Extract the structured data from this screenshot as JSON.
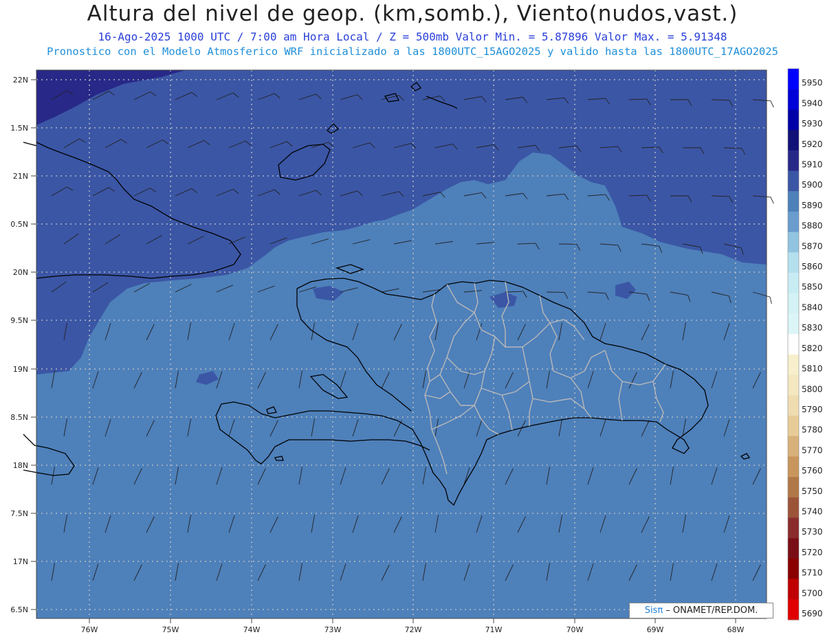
{
  "title": "Altura del nivel de geop. (km,somb.), Viento(nudos,vast.)",
  "subtitle_line1": "16-Ago-2025  1000 UTC / 7:00 am Hora Local / Z = 500mb    Valor Min. = 5.87896  Valor Max. = 5.91348",
  "subtitle_line2": "Pronostico con el Modelo Atmosferico WRF inicializado a las 1800UTC_15AGO2025 y valido hasta las  1800UTC_17AGO2025",
  "map": {
    "lat_labels": [
      "22N",
      "1.5N",
      "21N",
      "0.5N",
      "20N",
      "9.5N",
      "19N",
      "8.5N",
      "18N",
      "7.5N",
      "17N",
      "6.5N"
    ],
    "lon_labels": [
      "76W",
      "75W",
      "74W",
      "73W",
      "72W",
      "71W",
      "70W",
      "69W",
      "68W"
    ],
    "colors": {
      "field_main": "#4e80ba",
      "field_north": "#3b56a5",
      "field_far_north": "#2a2a86",
      "coast": "#000000",
      "provinces": "#b9b9b9",
      "grid": "#c8c8c8"
    }
  },
  "colorbar": {
    "levels": [
      "5950",
      "5940",
      "5930",
      "5920",
      "5910",
      "5900",
      "5890",
      "5880",
      "5870",
      "5860",
      "5850",
      "5840",
      "5830",
      "5820",
      "5810",
      "5800",
      "5790",
      "5780",
      "5770",
      "5760",
      "5750",
      "5740",
      "5730",
      "5720",
      "5710",
      "5700",
      "5690"
    ],
    "colors": [
      "#0000ff",
      "#0000d8",
      "#0000a8",
      "#111178",
      "#282888",
      "#3b56a5",
      "#4e80ba",
      "#6a9cce",
      "#92c4e2",
      "#b4e0ee",
      "#c8ecf4",
      "#d4f2f6",
      "#dcf6f8",
      "#ffffff",
      "#f8f0cc",
      "#f4e8c0",
      "#efdcb0",
      "#e8cc98",
      "#d8b07a",
      "#c8965c",
      "#b07848",
      "#9c5438",
      "#8a2c2c",
      "#7a0e16",
      "#8a0000",
      "#c00000",
      "#e00000"
    ]
  },
  "credit": {
    "brand": "Sisπ",
    "rest": " – ONAMET/REP.DOM."
  }
}
